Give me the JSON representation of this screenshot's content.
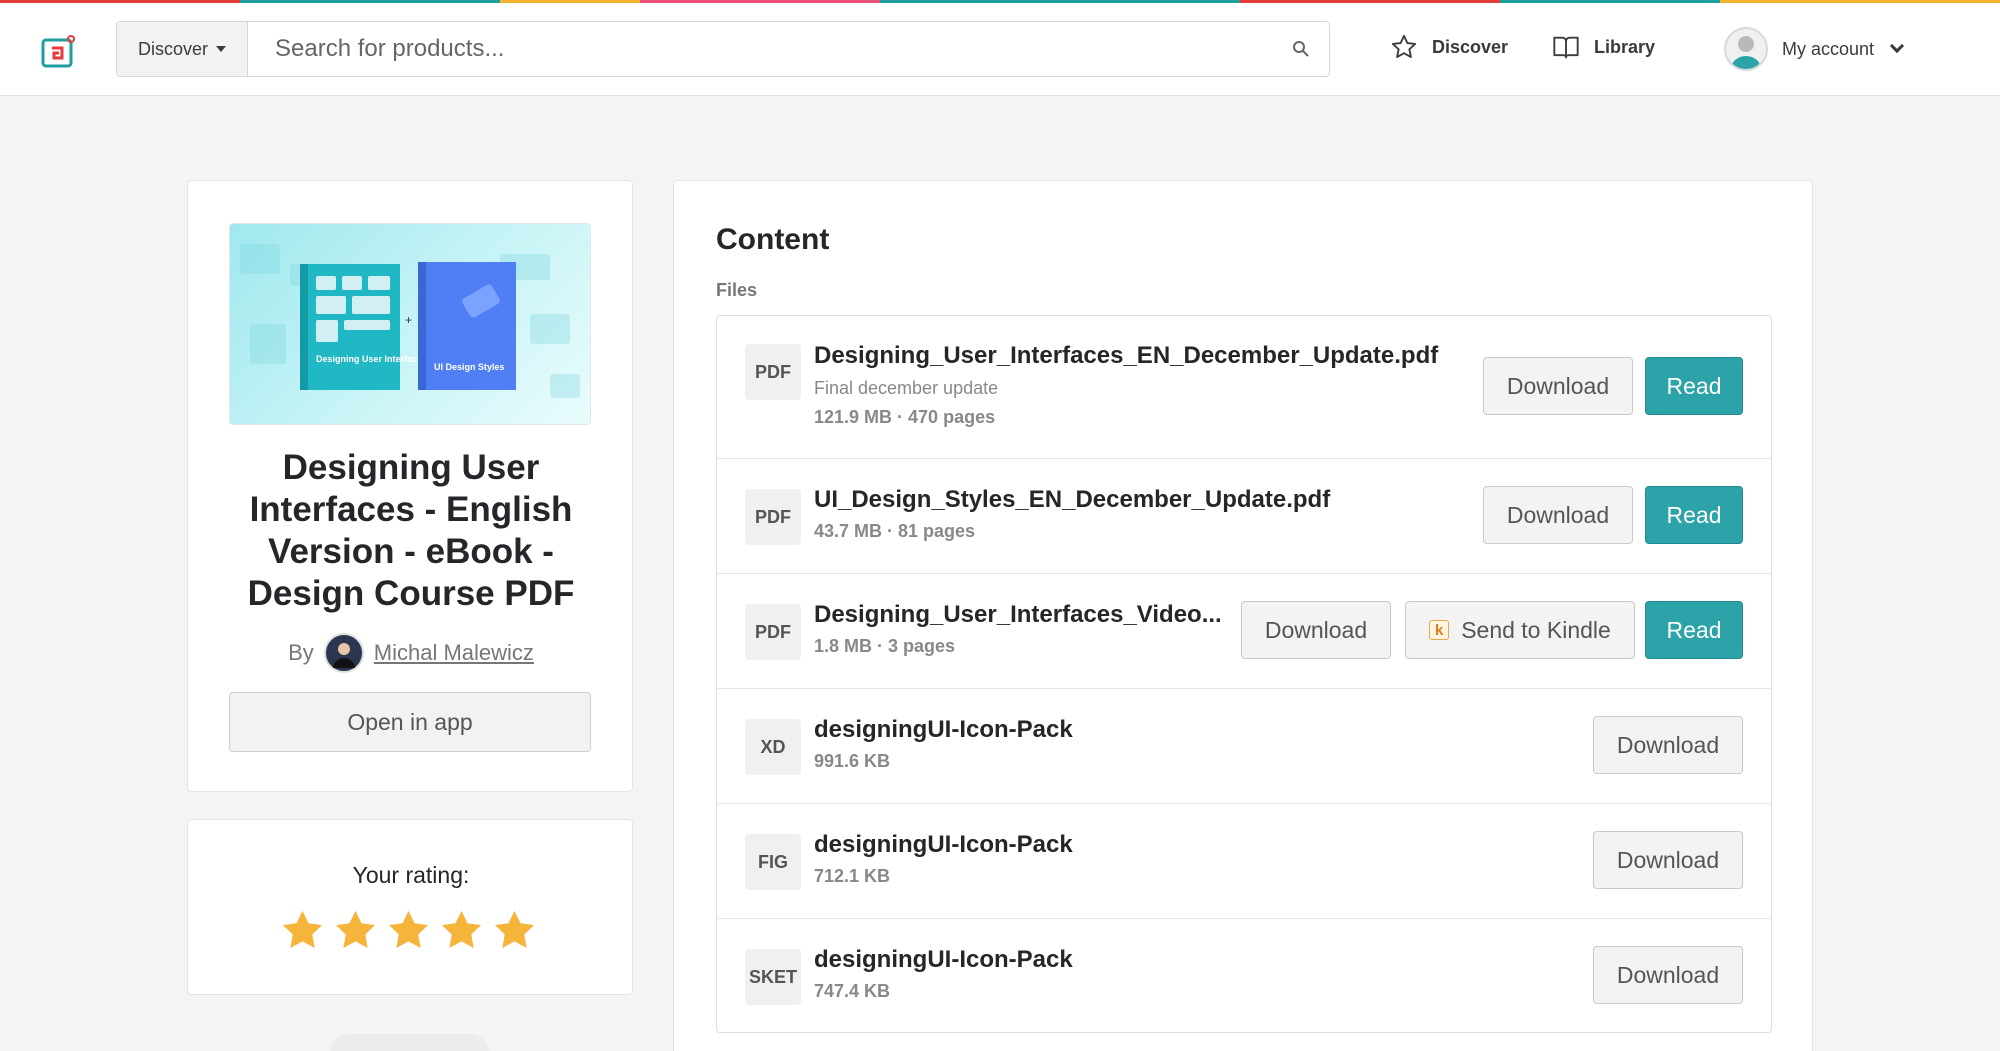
{
  "header": {
    "search_category": "Discover",
    "search_placeholder": "Search for products...",
    "nav_discover": "Discover",
    "nav_library": "Library",
    "account_label": "My account"
  },
  "product": {
    "title": "Designing User Interfaces - English Version - eBook - Design Course PDF",
    "by_label": "By",
    "author": "Michal Malewicz",
    "open_in_app": "Open in app",
    "cover_book1_title": "Designing User Interfaces",
    "cover_book2_title": "UI Design Styles"
  },
  "rating": {
    "label": "Your rating:",
    "value": 5,
    "max": 5
  },
  "content": {
    "title": "Content",
    "files_label": "Files",
    "download_label": "Download",
    "read_label": "Read",
    "kindle_label": "Send to Kindle",
    "files": [
      {
        "type": "PDF",
        "name": "Designing_User_Interfaces_EN_December_Update.pdf",
        "description": "Final december update",
        "meta": "121.9 MB · 470 pages"
      },
      {
        "type": "PDF",
        "name": "UI_Design_Styles_EN_December_Update.pdf",
        "meta": "43.7 MB · 81 pages"
      },
      {
        "type": "PDF",
        "name": "Designing_User_Interfaces_Video...",
        "meta": "1.8 MB · 3 pages"
      },
      {
        "type": "XD",
        "name": "designingUI-Icon-Pack",
        "meta": "991.6 KB"
      },
      {
        "type": "FIG",
        "name": "designingUI-Icon-Pack",
        "meta": "712.1 KB"
      },
      {
        "type": "SKET",
        "name": "designingUI-Icon-Pack",
        "meta": "747.4 KB"
      }
    ]
  },
  "colors": {
    "accent": "#2ba3a9",
    "star": "#f5b43a"
  }
}
